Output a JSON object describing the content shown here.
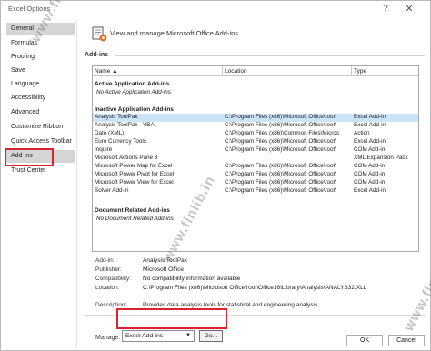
{
  "window": {
    "title": "Excel Options",
    "help_glyph": "?",
    "close_glyph": "✕"
  },
  "sidebar": {
    "items": [
      {
        "label": "General"
      },
      {
        "label": "Formulas"
      },
      {
        "label": "Proofing"
      },
      {
        "label": "Save"
      },
      {
        "label": "Language"
      },
      {
        "label": "Accessibility"
      },
      {
        "label": "Advanced"
      },
      {
        "label": "Customize Ribbon"
      },
      {
        "label": "Quick Access Toolbar"
      },
      {
        "label": "Add-ins"
      },
      {
        "label": "Trust Center"
      }
    ],
    "selected": "General",
    "active": "Add-ins"
  },
  "header": {
    "text": "View and manage Microsoft Office Add-ins.",
    "icon": "addins-gear-icon"
  },
  "section": {
    "label": "Add-ins"
  },
  "grid": {
    "columns": {
      "name": "Name ▲",
      "location": "Location",
      "type": "Type"
    },
    "groups": {
      "active": {
        "label": "Active Application Add-ins",
        "empty": "No Active Application Add-ins"
      },
      "inactive": {
        "label": "Inactive Application Add-ins"
      },
      "document": {
        "label": "Document Related Add-ins",
        "empty": "No Document Related Add-ins"
      }
    },
    "rows": [
      {
        "name": "Analysis ToolPak",
        "location": "C:\\Program Files (x86)\\Microsoft Office\\root\\",
        "type": "Excel Add-in"
      },
      {
        "name": "Analysis ToolPak - VBA",
        "location": "C:\\Program Files (x86)\\Microsoft Office\\root\\",
        "type": "Excel Add-in"
      },
      {
        "name": "Date (XML)",
        "location": "C:\\Program Files (x86)\\Common Files\\Micros",
        "type": "Action"
      },
      {
        "name": "Euro Currency Tools",
        "location": "C:\\Program Files (x86)\\Microsoft Office\\root\\",
        "type": "Excel Add-in"
      },
      {
        "name": "Inquire",
        "location": "C:\\Program Files (x86)\\Microsoft Office\\root\\",
        "type": "COM Add-in"
      },
      {
        "name": "Microsoft Actions Pane 3",
        "location": "",
        "type": "XML Expansion Pack"
      },
      {
        "name": "Microsoft Power Map for Excel",
        "location": "C:\\Program Files (x86)\\Microsoft Office\\root\\",
        "type": "COM Add-in"
      },
      {
        "name": "Microsoft Power Pivot for Excel",
        "location": "C:\\Program Files (x86)\\Microsoft Office\\root\\",
        "type": "COM Add-in"
      },
      {
        "name": "Microsoft Power View for Excel",
        "location": "C:\\Program Files (x86)\\Microsoft Office\\root\\",
        "type": "COM Add-in"
      },
      {
        "name": "Solver Add-in",
        "location": "C:\\Program Files (x86)\\Microsoft Office\\root\\",
        "type": "Excel Add-in"
      }
    ]
  },
  "details": {
    "addin_label": "Add-in:",
    "addin_value": "Analysis ToolPak",
    "publisher_label": "Publisher:",
    "publisher_value": "Microsoft Office",
    "compat_label": "Compatibility:",
    "compat_value": "No compatibility information available",
    "location_label": "Location:",
    "location_value": "C:\\Program Files (x86)\\Microsoft Office\\root\\Office16\\Library\\Analysis\\ANALYS32.XLL",
    "desc_label": "Description:",
    "desc_value": "Provides data analysis tools for statistical and engineering analysis"
  },
  "manage": {
    "label": "Manage:",
    "selected": "Excel Add-ins",
    "go_label": "Go..."
  },
  "buttons": {
    "ok": "OK",
    "cancel": "Cancel"
  },
  "watermark": {
    "text": "www.finlib.in"
  },
  "colors": {
    "highlight_red": "#d9232f",
    "selected_row": "#cce4f7",
    "sidebar_selected": "#d5d5d5"
  }
}
